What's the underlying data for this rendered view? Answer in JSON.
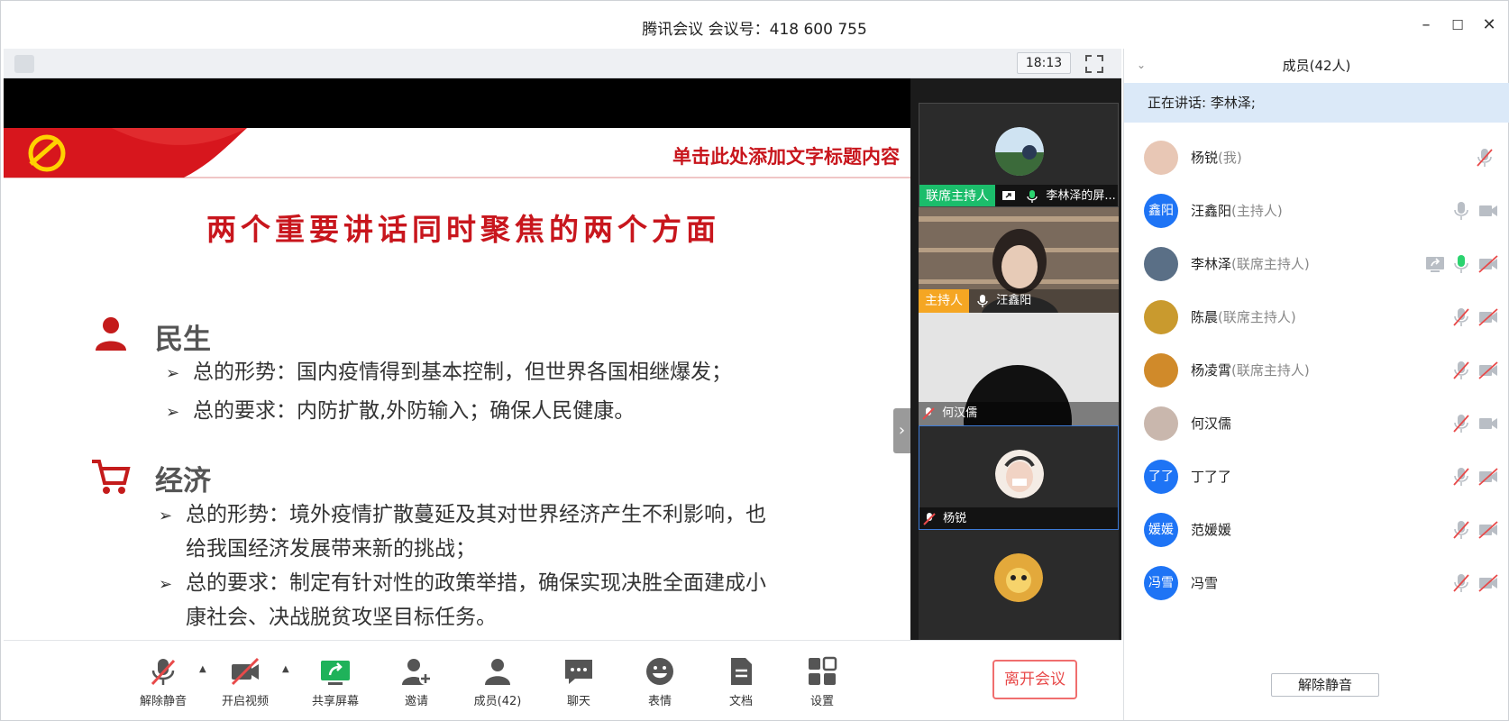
{
  "window": {
    "title": "腾讯会议 会议号：418 600 755",
    "minimize_symbol": "–",
    "maximize_symbol": "☐",
    "close_symbol": "✕"
  },
  "stage": {
    "clock": "18:13"
  },
  "slide": {
    "corner_title": "单击此处添加文字标题内容",
    "title": "两个重要讲话同时聚焦的两个方面",
    "sections": [
      {
        "heading": "民生",
        "icon": "person-icon",
        "bullets": [
          "总的形势：国内疫情得到基本控制，但世界各国相继爆发；",
          "总的要求：内防扩散,外防输入；确保人民健康。"
        ]
      },
      {
        "heading": "经济",
        "icon": "cart-icon",
        "bullets": [
          "总的形势：境外疫情扩散蔓延及其对世界经济产生不利影响，也",
          "给我国经济发展带来新的挑战；",
          "总的要求：制定有针对性的政策举措，确保实现决胜全面建成小",
          "康社会、决战脱贫攻坚目标任务。"
        ]
      }
    ]
  },
  "tiles": [
    {
      "tag": "联席主持人",
      "name": "李林泽的屏..."
    },
    {
      "tag": "主持人",
      "name": "汪鑫阳"
    },
    {
      "tag": "",
      "name": "何汉儒"
    },
    {
      "tag": "",
      "name": "杨锐"
    },
    {
      "tag": "",
      "name": ""
    }
  ],
  "toolbar": {
    "unmute": "解除静音",
    "start_video": "开启视频",
    "share_screen": "共享屏幕",
    "invite": "邀请",
    "members": "成员(42)",
    "chat": "聊天",
    "emoji": "表情",
    "docs": "文档",
    "settings": "设置",
    "leave": "离开会议"
  },
  "panel": {
    "header": "成员(42人)",
    "speaking": "正在讲话: 李林泽;",
    "unmute_all": "解除静音",
    "members": [
      {
        "name": "杨锐",
        "role": "(我)",
        "avatar_text": "",
        "avatar_color": "#e8c7b5",
        "mic": "muted",
        "video": "none",
        "share": false
      },
      {
        "name": "汪鑫阳",
        "role": "(主持人)",
        "avatar_text": "鑫阳",
        "avatar_color": "#1e74f5",
        "mic": "on",
        "video": "on",
        "share": false
      },
      {
        "name": "李林泽",
        "role": "(联席主持人)",
        "avatar_text": "",
        "avatar_color": "#5a6f86",
        "mic": "speaking",
        "video": "off",
        "share": true
      },
      {
        "name": "陈晨",
        "role": "(联席主持人)",
        "avatar_text": "",
        "avatar_color": "#c99a2e",
        "mic": "muted",
        "video": "off",
        "share": false
      },
      {
        "name": "杨凌霄",
        "role": "(联席主持人)",
        "avatar_text": "",
        "avatar_color": "#d08a2a",
        "mic": "muted",
        "video": "off",
        "share": false
      },
      {
        "name": "何汉儒",
        "role": "",
        "avatar_text": "",
        "avatar_color": "#c9b7ad",
        "mic": "muted",
        "video": "on",
        "share": false
      },
      {
        "name": "丁了了",
        "role": "",
        "avatar_text": "了了",
        "avatar_color": "#1e74f5",
        "mic": "muted",
        "video": "off",
        "share": false
      },
      {
        "name": "范媛媛",
        "role": "",
        "avatar_text": "媛媛",
        "avatar_color": "#1e74f5",
        "mic": "muted",
        "video": "off",
        "share": false
      },
      {
        "name": "冯雪",
        "role": "",
        "avatar_text": "冯雪",
        "avatar_color": "#1e74f5",
        "mic": "muted",
        "video": "off",
        "share": false
      }
    ]
  }
}
